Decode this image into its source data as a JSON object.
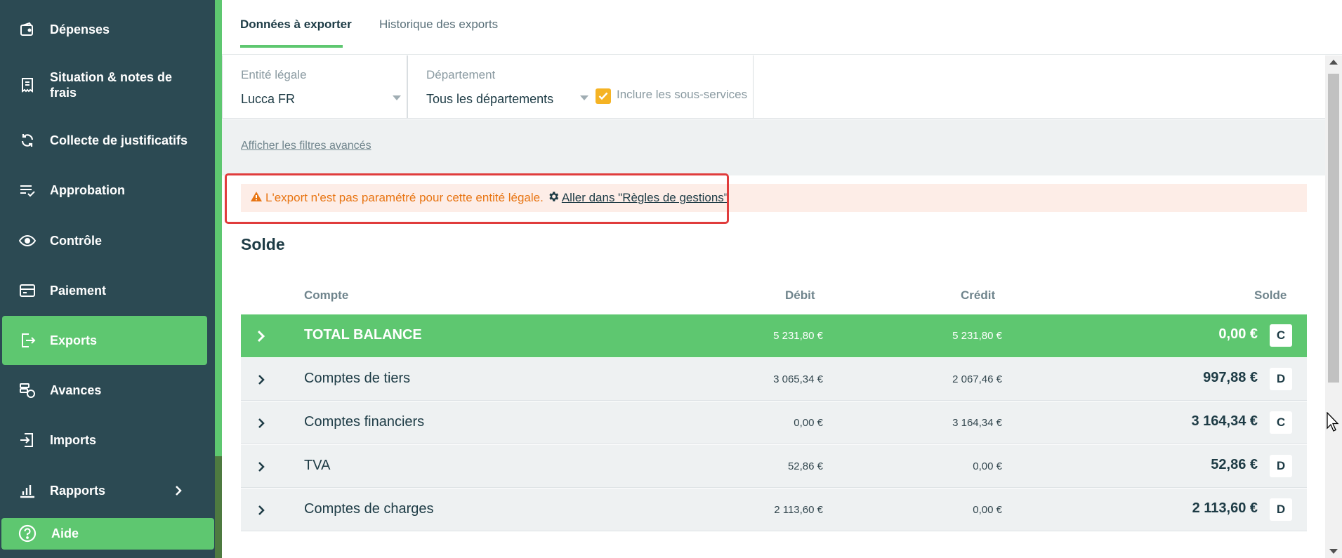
{
  "sidebar": {
    "items": [
      {
        "label": "Dépenses",
        "icon": "wallet-icon"
      },
      {
        "label": "Situation & notes de frais",
        "icon": "receipt-icon"
      },
      {
        "label": "Collecte de justificatifs",
        "icon": "sync-icon"
      },
      {
        "label": "Approbation",
        "icon": "checklist-icon"
      },
      {
        "label": "Contrôle",
        "icon": "eye-icon"
      },
      {
        "label": "Paiement",
        "icon": "credit-card-icon"
      },
      {
        "label": "Exports",
        "icon": "export-icon"
      },
      {
        "label": "Avances",
        "icon": "coins-icon"
      },
      {
        "label": "Imports",
        "icon": "import-icon"
      },
      {
        "label": "Rapports",
        "icon": "bar-chart-icon"
      }
    ],
    "active": "Exports",
    "help_label": "Aide"
  },
  "tabs": [
    "Données à exporter",
    "Historique des exports"
  ],
  "filters": {
    "entity_label": "Entité légale",
    "entity_value": "Lucca FR",
    "department_label": "Département",
    "department_value": "Tous les départements",
    "include_label": "Inclure les sous-services",
    "include_checked": true,
    "advanced_link": "Afficher les filtres avancés"
  },
  "warning": {
    "text": "L'export n'est pas paramétré pour cette entité légale.",
    "link": "Aller dans \"Règles de gestions\""
  },
  "section_title": "Solde",
  "table": {
    "headers": {
      "account": "Compte",
      "debit": "Débit",
      "credit": "Crédit",
      "balance": "Solde"
    },
    "rows": [
      {
        "name": "TOTAL BALANCE",
        "debit": "5 231,80 €",
        "credit": "5 231,80 €",
        "balance": "0,00 €",
        "badge": "C"
      },
      {
        "name": "Comptes de tiers",
        "debit": "3 065,34 €",
        "credit": "2 067,46 €",
        "balance": "997,88 €",
        "badge": "D"
      },
      {
        "name": "Comptes financiers",
        "debit": "0,00 €",
        "credit": "3 164,34 €",
        "balance": "3 164,34 €",
        "badge": "C"
      },
      {
        "name": "TVA",
        "debit": "52,86 €",
        "credit": "0,00 €",
        "balance": "52,86 €",
        "badge": "D"
      },
      {
        "name": "Comptes de charges",
        "debit": "2 113,60 €",
        "credit": "0,00 €",
        "balance": "2 113,60 €",
        "badge": "D"
      }
    ]
  },
  "colors": {
    "sidebar_bg": "#2c4a53",
    "accent_green": "#5ec770",
    "warning_orange": "#e87513",
    "warning_bg": "#fdede7",
    "highlight_red": "#e03c3c"
  }
}
